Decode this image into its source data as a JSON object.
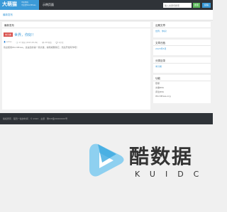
{
  "header": {
    "logo": "大萌猫",
    "logo_sub": "不正经的\n不正经WordPress",
    "nav_home": "示例页面",
    "search_placeholder": "输入关键词搜索",
    "search_btn": "搜索",
    "post_btn": "投稿"
  },
  "breadcrumb": "最新发布",
  "main": {
    "heading": "最新发布",
    "post": {
      "tag": "未分类",
      "title": "世界，你好！",
      "author": "admin",
      "date": "1个月前 (2023-05-09)",
      "views": "253浏览",
      "comments": "1评论",
      "excerpt": "欢迎使用WordPress。这是您的第一篇文章，编辑或删除它，然后开始写作吧！"
    }
  },
  "sidebar": {
    "recent_heading": "近期文章",
    "recent_item": "世界，你好！",
    "archive_heading": "文章归档",
    "archive_item": "2023年5月",
    "category_heading": "分类目录",
    "category_item": "未分类",
    "meta_heading": "功能",
    "meta_items": [
      "登录",
      "文章RSS",
      "评论RSS",
      "WordPress.org"
    ]
  },
  "footer": {
    "text": "版权所有 · 强烈一些的时间 · © 2023 · 主题 · 豫ICP备00000000号"
  },
  "watermark": {
    "title": "酷数据",
    "sub": "KUIDC"
  },
  "colors": {
    "accent": "#3b9ad8",
    "dark": "#2f3338",
    "tag": "#d9534f",
    "green": "#5cb85c"
  }
}
